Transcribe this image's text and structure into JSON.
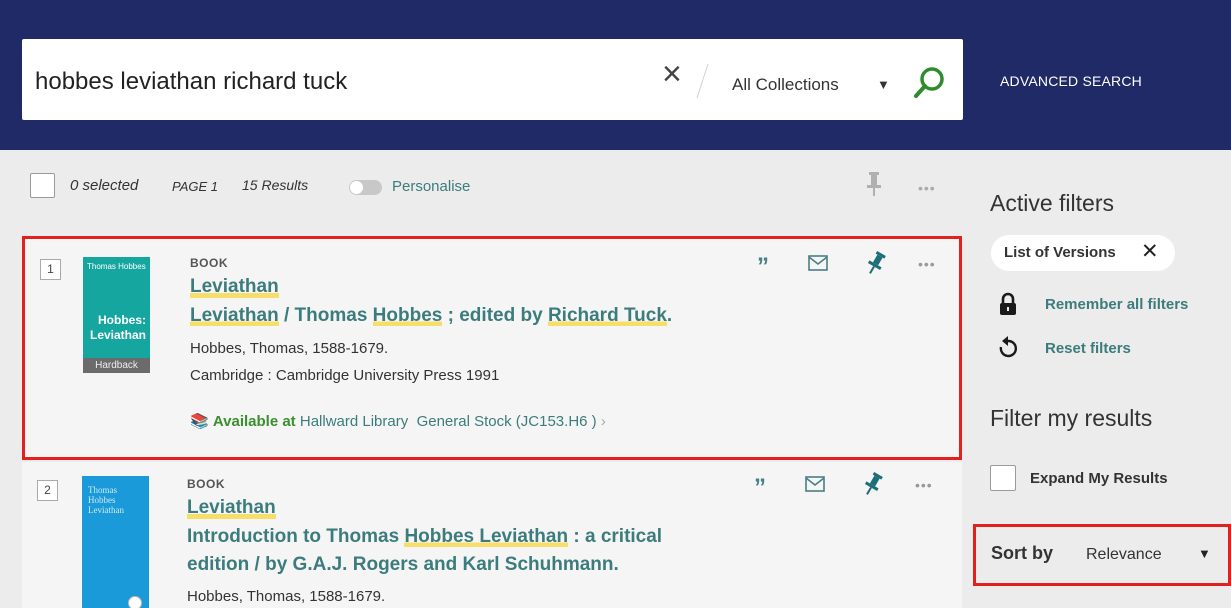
{
  "search": {
    "query": "hobbes leviathan richard tuck",
    "collection": "All Collections",
    "advanced_label": "ADVANCED SEARCH"
  },
  "toolbar": {
    "selected": "0 selected",
    "page": "PAGE 1",
    "results": "15 Results",
    "personalise": "Personalise"
  },
  "results": [
    {
      "num": "1",
      "type": "BOOK",
      "title": "Leviathan",
      "subtitle_parts": [
        "Leviathan",
        " / Thomas ",
        "Hobbes",
        " ; edited by ",
        "Richard Tuck",
        "."
      ],
      "author": "Hobbes, Thomas, 1588-1679.",
      "publisher": "Cambridge : Cambridge University Press 1991",
      "availability": {
        "status": "Available at",
        "library": "Hallward Library",
        "location": "General Stock (JC153.H6 )"
      },
      "cover": {
        "top_text": "Thomas Hobbes",
        "title_line1": "Hobbes:",
        "title_line2": "Leviathan",
        "band": "Hardback"
      }
    },
    {
      "num": "2",
      "type": "BOOK",
      "title": "Leviathan",
      "subtitle_line1_parts": [
        "Introduction to Thomas ",
        "Hobbes Leviathan",
        " : a critical"
      ],
      "subtitle_line2": "edition / by G.A.J. Rogers and Karl Schuhmann.",
      "author": "Hobbes, Thomas, 1588-1679.",
      "cover": {
        "line1": "Thomas",
        "line2": "Hobbes",
        "line3": "Leviathan"
      }
    }
  ],
  "sidebar": {
    "active_filters_title": "Active filters",
    "chip_label": "List of Versions",
    "remember": "Remember all filters",
    "reset": "Reset filters",
    "filter_title": "Filter my results",
    "expand": "Expand My Results",
    "sort_label": "Sort by",
    "sort_value": "Relevance"
  },
  "colors": {
    "header": "#1f2a66",
    "teal": "#3c7c7c",
    "highlight_border": "#e0211e",
    "available_green": "#3b8f2f",
    "search_green": "#2e8b2e"
  }
}
